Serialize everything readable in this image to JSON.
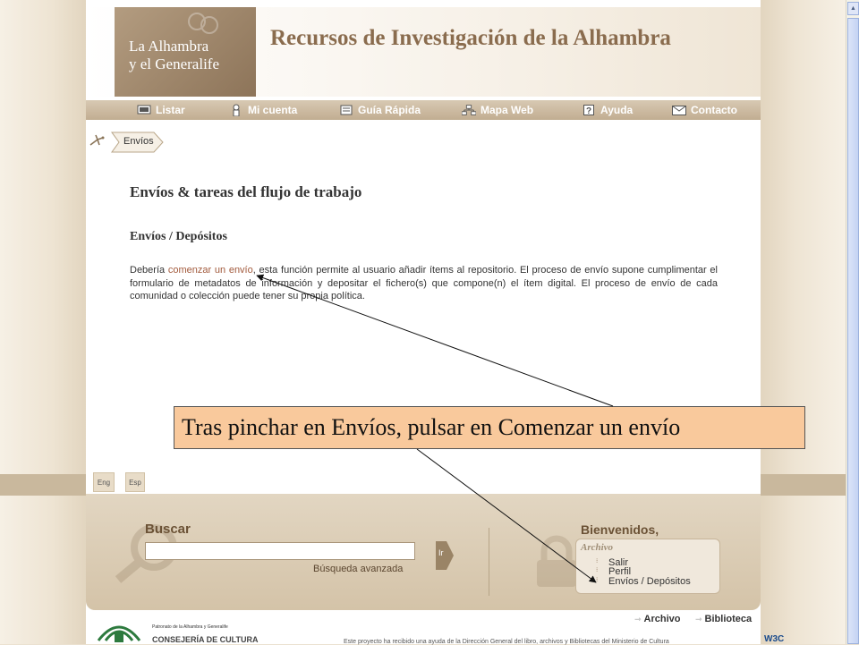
{
  "header": {
    "logo_line1": "La Alhambra",
    "logo_line2": "y el Generalife",
    "site_title": "Recursos de Investigación de la Alhambra"
  },
  "nav": [
    {
      "label": "Listar",
      "icon": "monitor-icon"
    },
    {
      "label": "Mi cuenta",
      "icon": "user-icon"
    },
    {
      "label": "Guía Rápida",
      "icon": "guide-icon"
    },
    {
      "label": "Mapa Web",
      "icon": "sitemap-icon"
    },
    {
      "label": "Ayuda",
      "icon": "help-icon"
    },
    {
      "label": "Contacto",
      "icon": "envelope-icon"
    }
  ],
  "breadcrumb": {
    "current": "Envíos"
  },
  "main": {
    "title": "Envíos & tareas del flujo de trabajo",
    "subtitle": "Envíos / Depósitos",
    "para_before": "Debería ",
    "para_link": "comenzar un envío",
    "para_after": ", esta función permite al usuario añadir ítems al repositorio. El proceso de envío supone cumplimentar el formulario de metadatos de información y depositar el fichero(s) que compone(n) el ítem digital. El proceso de envío de cada comunidad o colección puede tener su propia política."
  },
  "languages": {
    "eng": "Eng",
    "esp": "Esp"
  },
  "footer": {
    "search_label": "Buscar",
    "search_value": "",
    "go_label": "Ir",
    "advanced": "Búsqueda avanzada",
    "welcome": "Bienvenidos,",
    "user_menu_title": "Archivo",
    "user_menu": [
      "Salir",
      "Perfil",
      "Envíos / Depósitos"
    ]
  },
  "bottom": {
    "archivo": "Archivo",
    "biblioteca": "Biblioteca",
    "patronato": "Patronato de la Alhambra y Generalife",
    "consejeria": "CONSEJERÍA DE CULTURA",
    "funding": "Este proyecto ha recibido una ayuda de la Dirección General del libro, archivos y Bibliotecas del Ministerio de Cultura",
    "w3c": "W3C"
  },
  "callout": {
    "text": "Tras pinchar en Envíos, pulsar en Comenzar un envío"
  },
  "colors": {
    "accent": "#8a6c4e",
    "link": "#a25a3c",
    "callout_bg": "#f9c99c"
  }
}
